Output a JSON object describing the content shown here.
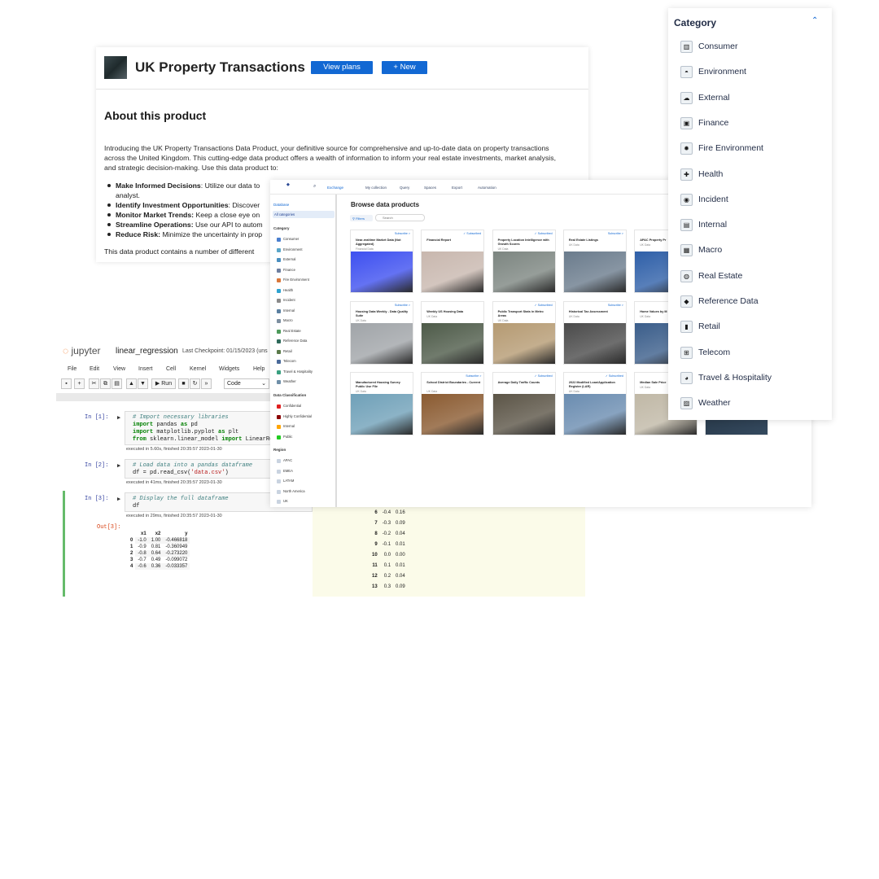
{
  "product": {
    "title": "UK Property Transactions",
    "view_plans": "View plans",
    "new_button": "+ New",
    "about_heading": "About this product",
    "intro": "Introducing the UK Property Transactions Data Product, your definitive source for comprehensive and up-to-date data on property transactions across the United Kingdom. This cutting-edge data product offers a wealth of information to inform your real estate investments, market analysis, and strategic decision-making. Use this data product to:",
    "bullets": [
      {
        "bold": "Make Informed Decisions",
        "text": ": Utilize our data to",
        "cont": "analyst."
      },
      {
        "bold": "Identify Investment Opportunities",
        "text": ": Discover"
      },
      {
        "bold": "Monitor Market Trends:",
        "text": " Keep a close eye on"
      },
      {
        "bold": "Streamline Operations:",
        "text": " Use our API to autom"
      },
      {
        "bold": "Reduce Risk:",
        "text": " Minimize the uncertainty in prop"
      }
    ],
    "footer": "This data product contains a number of different"
  },
  "jupyter": {
    "logo": "jupyter",
    "notebook_name": "linear_regression",
    "checkpoint": "Last Checkpoint: 01/15/2023   (uns",
    "menu": [
      "File",
      "Edit",
      "View",
      "Insert",
      "Cell",
      "Kernel",
      "Widgets",
      "Help"
    ],
    "run_label": "Run",
    "cell_type": "Code",
    "cells": [
      {
        "prompt": "In [1]:",
        "exec": "executed in 5.60s, finished 20:35:57 2023-01-30"
      },
      {
        "prompt": "In [2]:",
        "exec": "executed in 41ms, finished 20:35:57 2023-01-30"
      },
      {
        "prompt": "In [3]:",
        "exec": "executed in 29ms, finished 20:35:57 2023-01-30"
      }
    ],
    "code": {
      "c1_comment": "# Import necessary libraries",
      "c1_l2a": "import",
      "c1_l2b": " pandas ",
      "c1_l2c": "as",
      "c1_l2d": " pd",
      "c1_l3a": "import",
      "c1_l3b": " matplotlib.pyplot ",
      "c1_l3c": "as",
      "c1_l3d": " plt",
      "c1_l4a": "from",
      "c1_l4b": " sklearn.linear_model ",
      "c1_l4c": "import",
      "c1_l4d": " LinearRe",
      "c2_comment": "# Load data into a pandas dataframe",
      "c2_l2a": "df = pd.read_csv(",
      "c2_l2b": "'data.csv'",
      "c2_l2c": ")",
      "c3_comment": "# Display the full dataframe",
      "c3_l2": "df"
    },
    "out_prompt": "Out[3]:",
    "df_headers": [
      "",
      "x1",
      "x2",
      "y"
    ],
    "df_rows": [
      [
        "0",
        "-1.0",
        "1.00",
        "-0.466818"
      ],
      [
        "1",
        "-0.9",
        "0.81",
        "-0.360949"
      ],
      [
        "2",
        "-0.8",
        "0.64",
        "-0.273220"
      ],
      [
        "3",
        "-0.7",
        "0.49",
        "-0.099072"
      ],
      [
        "4",
        "-0.6",
        "0.36",
        "-0.033357"
      ]
    ],
    "right_rows": [
      [
        "6",
        "-0.4",
        "0.16"
      ],
      [
        "7",
        "-0.3",
        "0.09"
      ],
      [
        "8",
        "-0.2",
        "0.04"
      ],
      [
        "9",
        "-0.1",
        "0.01"
      ],
      [
        "10",
        "0.0",
        "0.00"
      ],
      [
        "11",
        "0.1",
        "0.01"
      ],
      [
        "12",
        "0.2",
        "0.04"
      ],
      [
        "13",
        "0.3",
        "0.09"
      ]
    ]
  },
  "exchange": {
    "nav": [
      "Exchange",
      "My collection",
      "Query",
      "Spaces",
      "Export",
      "Automation"
    ],
    "side_top": "Database",
    "all_categories": "All categories",
    "category_head": "Category",
    "categories": [
      "Consumer",
      "Environment",
      "External",
      "Finance",
      "Fire Environment",
      "Health",
      "Incident",
      "Internal",
      "Macro",
      "Real Estate",
      "Reference Data",
      "Retail",
      "Telecom",
      "Travel & Hospitality",
      "Weather"
    ],
    "classification_head": "Data Classification",
    "classifications": [
      {
        "label": "Confidential",
        "color": "#e02020"
      },
      {
        "label": "Highly Confidential",
        "color": "#8b0000"
      },
      {
        "label": "Internal",
        "color": "#ffa500"
      },
      {
        "label": "Public",
        "color": "#22cc22"
      }
    ],
    "region_head": "Region",
    "regions": [
      "APAC",
      "EMEA",
      "LATAM",
      "North America",
      "UK"
    ],
    "browse_title": "Browse data products",
    "filters": "Filters",
    "search_placeholder": "Search",
    "cards": [
      {
        "status": "Subscribe >",
        "title": "Near-realtime Market Data (Not Aggregated)",
        "source": "Financial Data",
        "img": "#3d4ff0"
      },
      {
        "status": "✓ Subscribed",
        "title": "Financial Report",
        "source": "",
        "img": "#c8b7ae"
      },
      {
        "status": "✓ Subscribed",
        "title": "Property Location Intelligence with Growth Scores",
        "source": "UK Data",
        "img": "#7c8580"
      },
      {
        "status": "Subscribe >",
        "title": "Real Estate Listings",
        "source": "UK Data",
        "img": "#6a7b8c"
      },
      {
        "status": "",
        "title": "APAC Property Pr",
        "source": "UK Data",
        "img": "#2e5fa8"
      },
      {
        "status": "Subscribe >",
        "title": "Housing Data Weekly - Data Quality Suite",
        "source": "UK Data",
        "img": "#a0a4a8"
      },
      {
        "status": "",
        "title": "Weekly US Housing Data",
        "source": "UK Data",
        "img": "#4d5a48"
      },
      {
        "status": "✓ Subscribed",
        "title": "Public Transport Stats in Metro Areas",
        "source": "UK Data",
        "img": "#b59a72"
      },
      {
        "status": "Subscribe >",
        "title": "Historical Tax Assessment",
        "source": "UK Data",
        "img": "#4a4a4a"
      },
      {
        "status": "",
        "title": "Home Values by M",
        "source": "UK Data",
        "img": "#3a5d8a"
      },
      {
        "status": "",
        "title": "Manufactured Housing Survey Public Use File",
        "source": "UK Data",
        "img": "#6fa0b8"
      },
      {
        "status": "Subscribe >",
        "title": "School District Boundaries - Current",
        "source": "UK Data",
        "img": "#8a5a30"
      },
      {
        "status": "✓ Subscribed",
        "title": "Average Daily Traffic Counts",
        "source": "",
        "img": "#5b5446"
      },
      {
        "status": "✓ Subscribed",
        "title": "2022 Modified Loan/Application Register (LAR)",
        "source": "UK Data",
        "img": "#6a8cb0"
      },
      {
        "status": "",
        "title": "Median Sale Price",
        "source": "UK Data",
        "img": "#c0b8a6"
      }
    ]
  },
  "category_panel": {
    "title": "Category",
    "items": [
      {
        "label": "Consumer",
        "icon": "consumer-icon",
        "glyph": "▥"
      },
      {
        "label": "Environment",
        "icon": "environment-icon",
        "glyph": "◓"
      },
      {
        "label": "External",
        "icon": "external-icon",
        "glyph": "☁"
      },
      {
        "label": "Finance",
        "icon": "finance-icon",
        "glyph": "▣"
      },
      {
        "label": "Fire Environment",
        "icon": "fire-environment-icon",
        "glyph": "✹"
      },
      {
        "label": "Health",
        "icon": "health-icon",
        "glyph": "✚"
      },
      {
        "label": "Incident",
        "icon": "incident-icon",
        "glyph": "◉"
      },
      {
        "label": "Internal",
        "icon": "internal-icon",
        "glyph": "▤"
      },
      {
        "label": "Macro",
        "icon": "macro-icon",
        "glyph": "▦"
      },
      {
        "label": "Real Estate",
        "icon": "real-estate-icon",
        "glyph": "◍"
      },
      {
        "label": "Reference Data",
        "icon": "reference-data-icon",
        "glyph": "◆"
      },
      {
        "label": "Retail",
        "icon": "retail-icon",
        "glyph": "▮"
      },
      {
        "label": "Telecom",
        "icon": "telecom-icon",
        "glyph": "⊞"
      },
      {
        "label": "Travel & Hospitality",
        "icon": "travel-hospitality-icon",
        "glyph": "◕"
      },
      {
        "label": "Weather",
        "icon": "weather-icon",
        "glyph": "▨"
      }
    ]
  },
  "colors": {
    "accent": "#1268d3",
    "jupyter_orange": "#f37726",
    "cell_active": "#66bb6a"
  }
}
